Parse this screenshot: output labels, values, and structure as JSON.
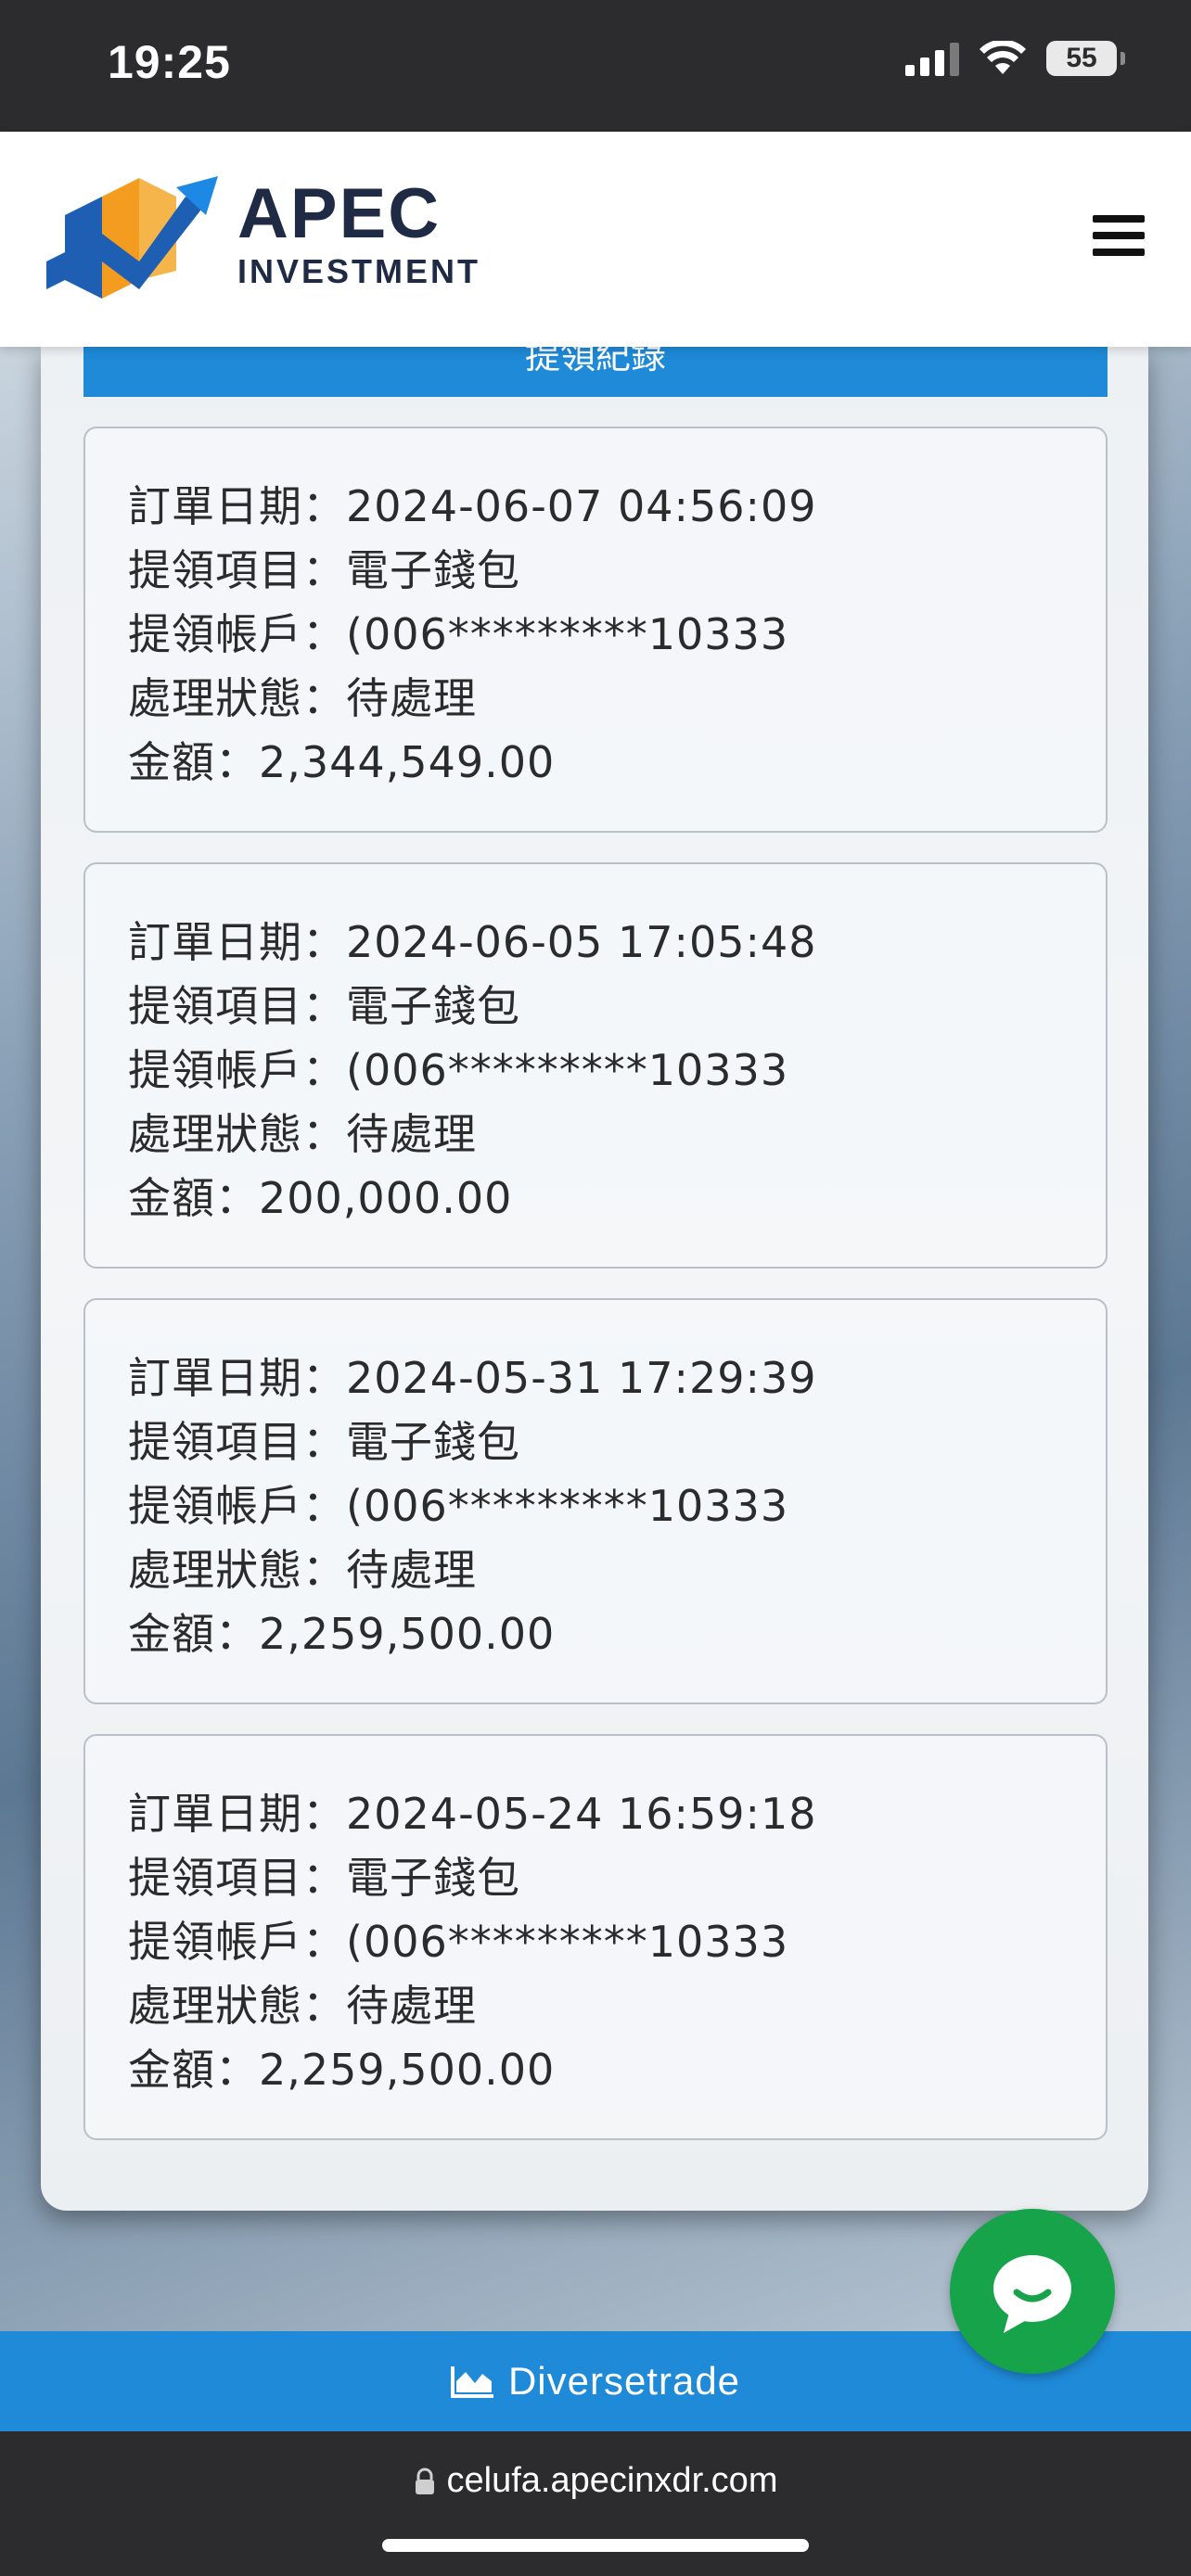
{
  "status_bar": {
    "time": "19:25",
    "battery": "55"
  },
  "header": {
    "logo_main": "APEC",
    "logo_sub": "INVESTMENT"
  },
  "section_title": "提領紀錄",
  "records": [
    {
      "date_label": "訂單日期：",
      "date": "2024-06-07 04:56:09",
      "item_label": "提領項目：",
      "item": "電子錢包",
      "account_label": "提領帳戶：",
      "account": "(006*********10333",
      "status_label": "處理狀態：",
      "status": "待處理",
      "amount_label": "金額：",
      "amount": "2,344,549.00"
    },
    {
      "date_label": "訂單日期：",
      "date": "2024-06-05 17:05:48",
      "item_label": "提領項目：",
      "item": "電子錢包",
      "account_label": "提領帳戶：",
      "account": "(006*********10333",
      "status_label": "處理狀態：",
      "status": "待處理",
      "amount_label": "金額：",
      "amount": "200,000.00"
    },
    {
      "date_label": "訂單日期：",
      "date": "2024-05-31 17:29:39",
      "item_label": "提領項目：",
      "item": "電子錢包",
      "account_label": "提領帳戶：",
      "account": "(006*********10333",
      "status_label": "處理狀態：",
      "status": "待處理",
      "amount_label": "金額：",
      "amount": "2,259,500.00"
    },
    {
      "date_label": "訂單日期：",
      "date": "2024-05-24 16:59:18",
      "item_label": "提領項目：",
      "item": "電子錢包",
      "account_label": "提領帳戶：",
      "account": "(006*********10333",
      "status_label": "處理狀態：",
      "status": "待處理",
      "amount_label": "金額：",
      "amount": "2,259,500.00"
    }
  ],
  "footer": {
    "label": "Diversetrade",
    "icon": "area-chart-icon"
  },
  "browser": {
    "url": "celufa.apecinxdr.com",
    "icon": "lock-icon"
  },
  "colors": {
    "accent": "#1f8ad8",
    "chat": "#16a34a",
    "logo_orange": "#f39c1f",
    "logo_blue": "#1e5fb3"
  }
}
